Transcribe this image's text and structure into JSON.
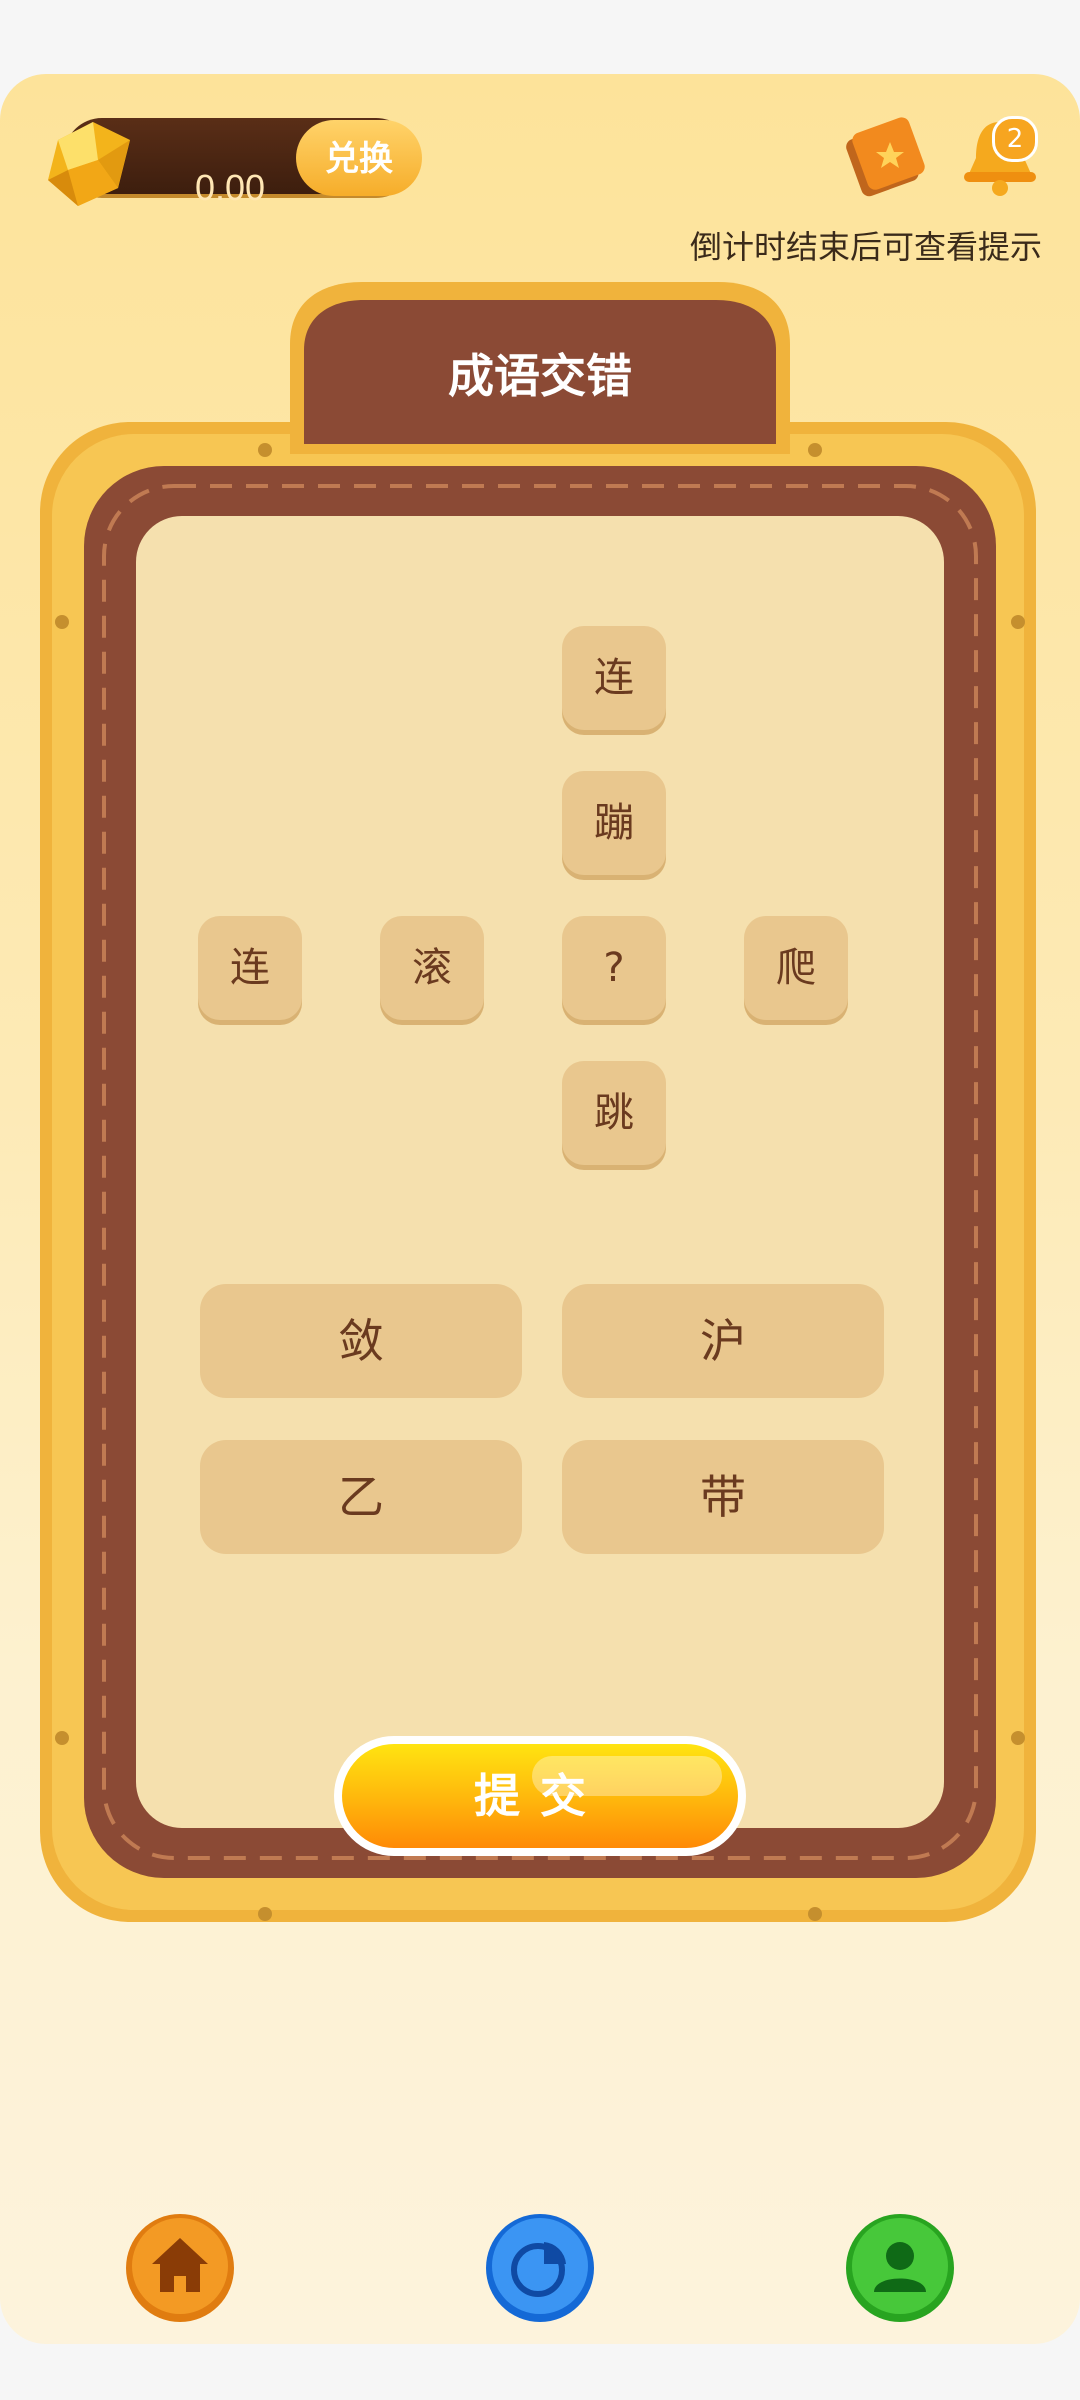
{
  "header": {
    "balance": "0.00",
    "exchange_label": "兑换",
    "notification_count": "2",
    "hint": "倒计时结束后可查看提示"
  },
  "board": {
    "title": "成语交错",
    "grid": [
      {
        "char": "连"
      },
      {
        "char": "蹦"
      },
      {
        "char": "连"
      },
      {
        "char": "滚"
      },
      {
        "char": "?"
      },
      {
        "char": "爬"
      },
      {
        "char": "跳"
      }
    ],
    "choices": [
      "敛",
      "沪",
      "乙",
      "带"
    ],
    "submit_label": "提交"
  },
  "nav": {
    "items": [
      "home-icon",
      "chart-icon",
      "profile-icon"
    ]
  },
  "colors": {
    "accent": "#ffb50c",
    "brown": "#8b4a35",
    "tile": "#e9c78e"
  }
}
